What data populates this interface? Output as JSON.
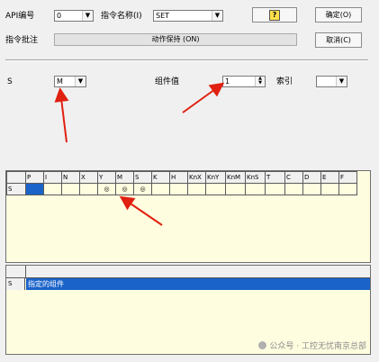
{
  "header": {
    "api_label": "API编号",
    "api_value": "0",
    "cmd_name_label": "指令名称(I)",
    "cmd_name_value": "SET",
    "help_icon": "?",
    "ok_button": "确定(O)",
    "note_label": "指令批注",
    "note_value": "动作保持 (ON)",
    "cancel_button": "取消(C)"
  },
  "params": {
    "s_label": "S",
    "s_value": "M",
    "component_label": "组件值",
    "component_value": "1",
    "index_label": "索引",
    "index_value": ""
  },
  "grid": {
    "corner": "",
    "columns": [
      "P",
      "I",
      "N",
      "X",
      "Y",
      "M",
      "S",
      "K",
      "H",
      "KnX",
      "KnY",
      "KnM",
      "KnS",
      "T",
      "C",
      "D",
      "E",
      "F"
    ],
    "row_label": "S",
    "cells": [
      "",
      "",
      "",
      "",
      "◎",
      "◎",
      "◎",
      "",
      "",
      "",
      "",
      "",
      "",
      "",
      "",
      "",
      "",
      ""
    ]
  },
  "desc_grid": {
    "row_label": "S",
    "value": "指定的组件"
  },
  "watermark": "公众号 · 工控无忧南京总部",
  "colors": {
    "selection": "#1a63c9",
    "grid_bg": "#fffde0",
    "annotation_arrow": "#e02010"
  }
}
